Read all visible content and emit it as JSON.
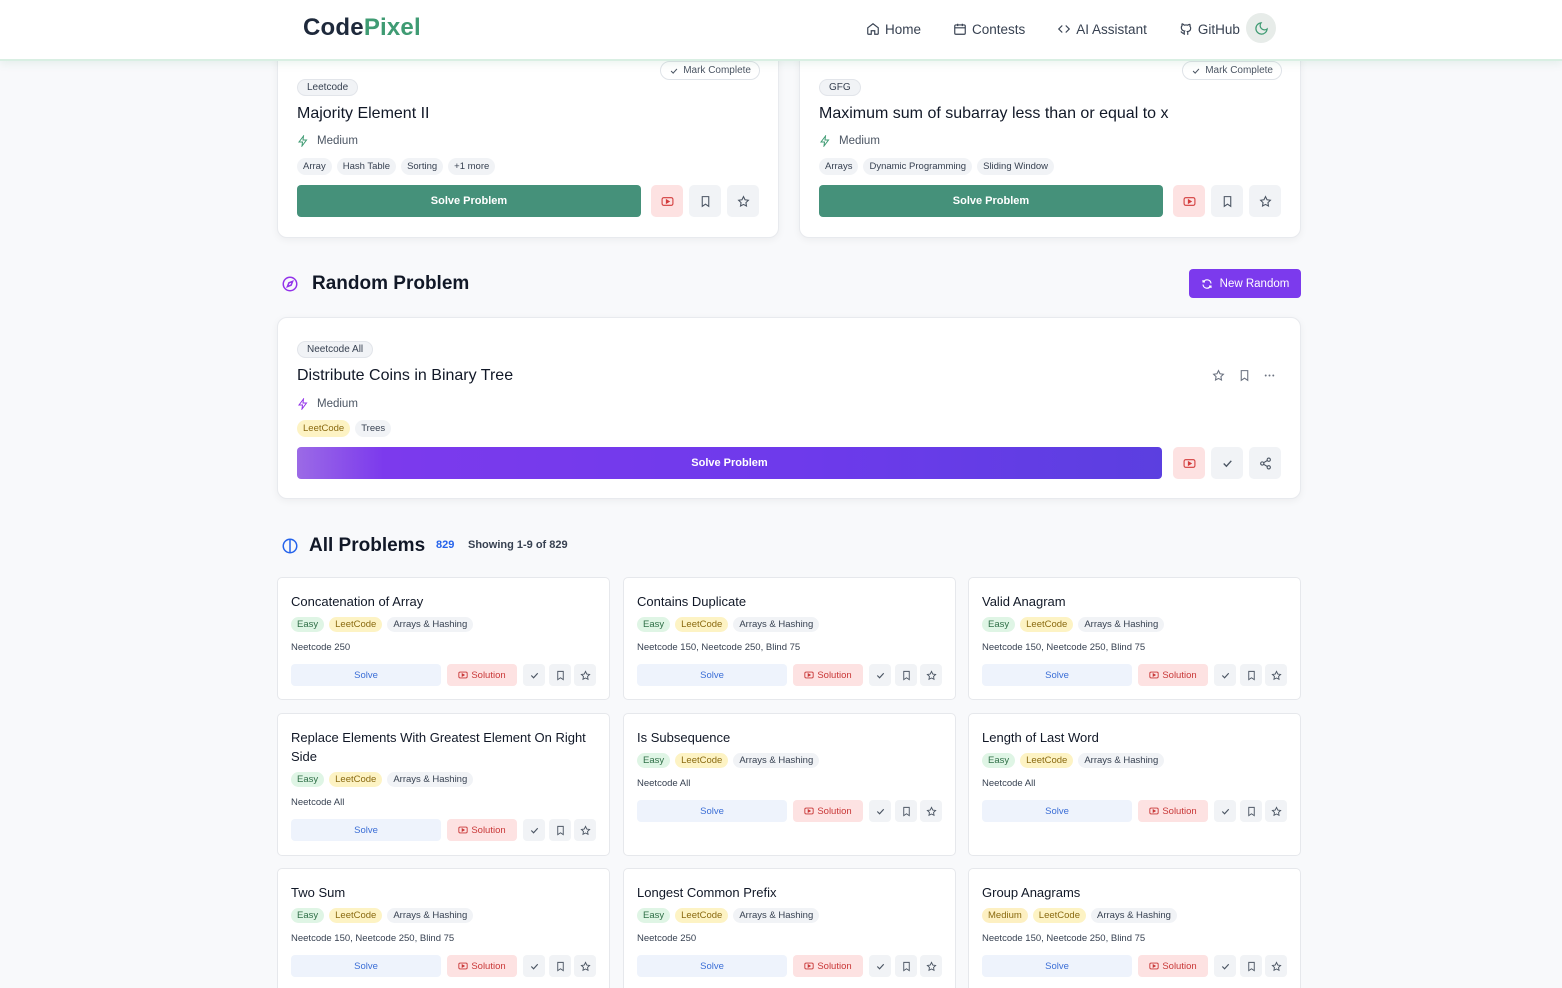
{
  "header": {
    "logo_part1": "Code",
    "logo_part2": "Pixel",
    "nav": [
      {
        "label": "Home",
        "icon": "home-icon"
      },
      {
        "label": "Contests",
        "icon": "calendar-icon"
      },
      {
        "label": "AI Assistant",
        "icon": "code-icon"
      },
      {
        "label": "GitHub",
        "icon": "github-icon"
      }
    ],
    "theme_icon": "moon-icon"
  },
  "top_cards": [
    {
      "source": "Leetcode",
      "mark_label": "Mark Complete",
      "title": "Majority Element II",
      "difficulty": "Medium",
      "tags": [
        "Array",
        "Hash Table",
        "Sorting",
        "+1 more"
      ],
      "solve_label": "Solve Problem"
    },
    {
      "source": "GFG",
      "mark_label": "Mark Complete",
      "title": "Maximum sum of subarray less than or equal to x",
      "difficulty": "Medium",
      "tags": [
        "Arrays",
        "Dynamic Programming",
        "Sliding Window"
      ],
      "solve_label": "Solve Problem"
    }
  ],
  "random": {
    "heading": "Random Problem",
    "new_random_label": "New Random",
    "source": "Neetcode All",
    "title": "Distribute Coins in Binary Tree",
    "difficulty": "Medium",
    "tags": [
      "LeetCode",
      "Trees"
    ],
    "solve_label": "Solve Problem"
  },
  "all": {
    "heading": "All Problems",
    "count": "829",
    "showing": "Showing 1-9 of 829",
    "solve_label": "Solve",
    "solution_label": "Solution",
    "problems": [
      {
        "title": "Concatenation of Array",
        "difficulty": "Easy",
        "platform": "LeetCode",
        "category": "Arrays & Hashing",
        "lists": "Neetcode 250"
      },
      {
        "title": "Contains Duplicate",
        "difficulty": "Easy",
        "platform": "LeetCode",
        "category": "Arrays & Hashing",
        "lists": "Neetcode 150, Neetcode 250, Blind 75"
      },
      {
        "title": "Valid Anagram",
        "difficulty": "Easy",
        "platform": "LeetCode",
        "category": "Arrays & Hashing",
        "lists": "Neetcode 150, Neetcode 250, Blind 75"
      },
      {
        "title": "Replace Elements With Greatest Element On Right Side",
        "difficulty": "Easy",
        "platform": "LeetCode",
        "category": "Arrays & Hashing",
        "lists": "Neetcode All"
      },
      {
        "title": "Is Subsequence",
        "difficulty": "Easy",
        "platform": "LeetCode",
        "category": "Arrays & Hashing",
        "lists": "Neetcode All"
      },
      {
        "title": "Length of Last Word",
        "difficulty": "Easy",
        "platform": "LeetCode",
        "category": "Arrays & Hashing",
        "lists": "Neetcode All"
      },
      {
        "title": "Two Sum",
        "difficulty": "Easy",
        "platform": "LeetCode",
        "category": "Arrays & Hashing",
        "lists": "Neetcode 150, Neetcode 250, Blind 75"
      },
      {
        "title": "Longest Common Prefix",
        "difficulty": "Easy",
        "platform": "LeetCode",
        "category": "Arrays & Hashing",
        "lists": "Neetcode 250"
      },
      {
        "title": "Group Anagrams",
        "difficulty": "Medium",
        "platform": "LeetCode",
        "category": "Arrays & Hashing",
        "lists": "Neetcode 150, Neetcode 250, Blind 75"
      }
    ]
  },
  "colors": {
    "brand": "#3f9b73",
    "accent_purple": "#7c3aed",
    "solve_green": "#45917a"
  }
}
